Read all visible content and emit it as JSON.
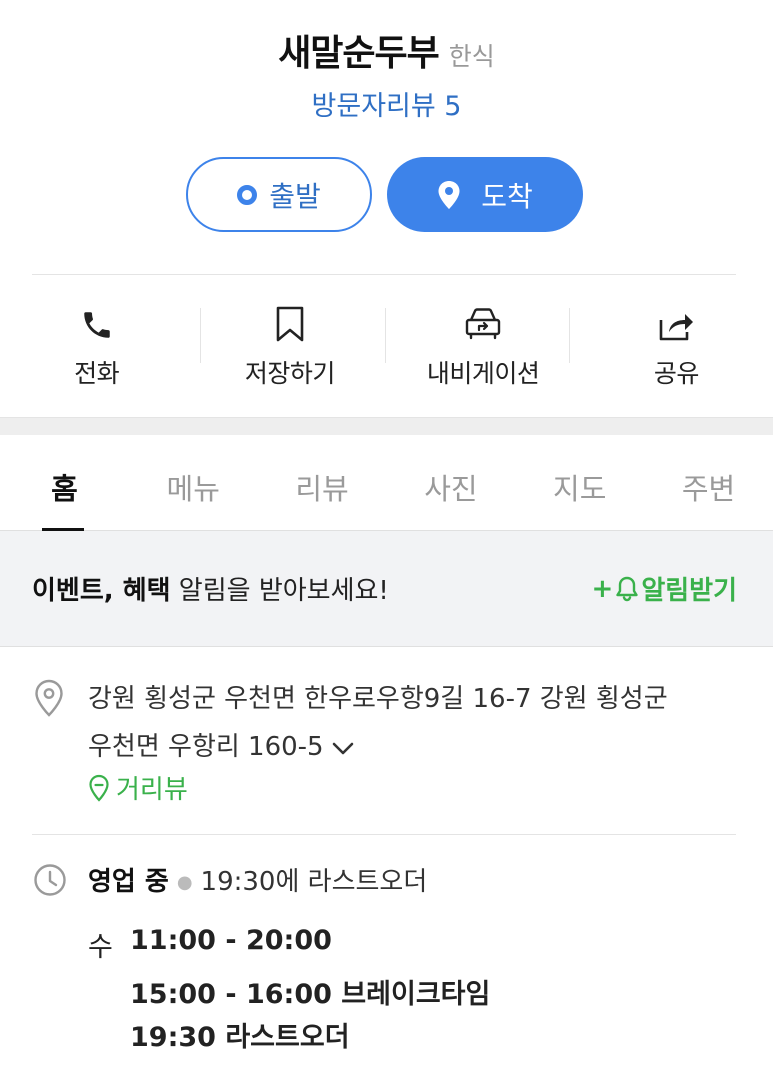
{
  "place": {
    "name": "새말순두부",
    "category": "한식",
    "review_link": "방문자리뷰 5"
  },
  "route": {
    "depart_label": "출발",
    "arrive_label": "도착"
  },
  "actions": [
    {
      "label": "전화",
      "icon": "phone-icon"
    },
    {
      "label": "저장하기",
      "icon": "bookmark-icon"
    },
    {
      "label": "내비게이션",
      "icon": "car-navigation-icon"
    },
    {
      "label": "공유",
      "icon": "share-icon"
    }
  ],
  "tabs": [
    "홈",
    "메뉴",
    "리뷰",
    "사진",
    "지도",
    "주변"
  ],
  "active_tab": "홈",
  "event": {
    "strong": "이벤트, 혜택",
    "text": " 알림을 받아보세요!",
    "action_plus": "+",
    "action_label": "알림받기"
  },
  "address": {
    "line1": "강원 횡성군 우천면 한우로우항9길 16-7 강원 횡성군",
    "line2": "우천면 우항리 160-5",
    "street_view": "거리뷰"
  },
  "hours": {
    "status": "영업 중",
    "last_order_note": "19:30에 라스트오더",
    "day": "수",
    "open": "11:00 - 20:00",
    "break": "15:00 - 16:00 브레이크타임",
    "last_order": "19:30 라스트오더"
  },
  "colors": {
    "accent_blue": "#3d83ea",
    "link_blue": "#2f6fc4",
    "green": "#3ab14b"
  }
}
